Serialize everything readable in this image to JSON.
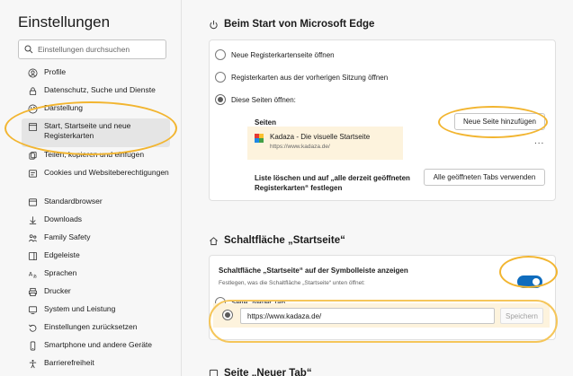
{
  "sidebar": {
    "title": "Einstellungen",
    "search_placeholder": "Einstellungen durchsuchen",
    "items": [
      {
        "label": "Profile",
        "icon": "profile-icon"
      },
      {
        "label": "Datenschutz, Suche und Dienste",
        "icon": "lock-icon"
      },
      {
        "label": "Darstellung",
        "icon": "palette-icon"
      },
      {
        "label": "Start, Startseite und neue Registerkarten",
        "icon": "start-page-icon",
        "active": true
      },
      {
        "label": "Teilen, kopieren und einfügen",
        "icon": "share-icon"
      },
      {
        "label": "Cookies und Websiteberechtigungen",
        "icon": "cookie-icon"
      },
      {
        "label": "Standardbrowser",
        "icon": "browser-icon"
      },
      {
        "label": "Downloads",
        "icon": "download-icon"
      },
      {
        "label": "Family Safety",
        "icon": "family-icon"
      },
      {
        "label": "Edgeleiste",
        "icon": "sidebar-icon"
      },
      {
        "label": "Sprachen",
        "icon": "language-icon"
      },
      {
        "label": "Drucker",
        "icon": "printer-icon"
      },
      {
        "label": "System und Leistung",
        "icon": "system-icon"
      },
      {
        "label": "Einstellungen zurücksetzen",
        "icon": "reset-icon"
      },
      {
        "label": "Smartphone und andere Geräte",
        "icon": "phone-icon"
      },
      {
        "label": "Barrierefreiheit",
        "icon": "accessibility-icon"
      }
    ]
  },
  "start_section": {
    "title": "Beim Start von Microsoft Edge",
    "options": [
      {
        "label": "Neue Registerkartenseite öffnen",
        "checked": false
      },
      {
        "label": "Registerkarten aus der vorherigen Sitzung öffnen",
        "checked": false
      },
      {
        "label": "Diese Seiten öffnen:",
        "checked": true
      }
    ],
    "pages_label": "Seiten",
    "add_page_button": "Neue Seite hinzufügen",
    "page_entry": {
      "title": "Kadaza - Die visuelle Startseite",
      "url": "https://www.kadaza.de/"
    },
    "more_label": "...",
    "replace_label": "Liste löschen und auf „alle derzeit geöffneten Registerkarten“ festlegen",
    "use_open_tabs_button": "Alle geöffneten Tabs verwenden"
  },
  "home_section": {
    "title": "Schaltfläche „Startseite“",
    "toggle_label": "Schaltfläche „Startseite“ auf der Symbolleiste anzeigen",
    "toggle_on": true,
    "toggle_desc": "Festlegen, was die Schaltfläche „Startseite“ unten öffnet:",
    "option_new_tab": "Seite „Neuer Tab“",
    "url_value": "https://www.kadaza.de/",
    "save_button": "Speichern"
  },
  "next_section_title_partial": "Seite „Neuer Tab“",
  "colors": {
    "accent": "#0f6cbd",
    "highlight": "#f2b530",
    "entry_bg": "#fdf3dd"
  }
}
